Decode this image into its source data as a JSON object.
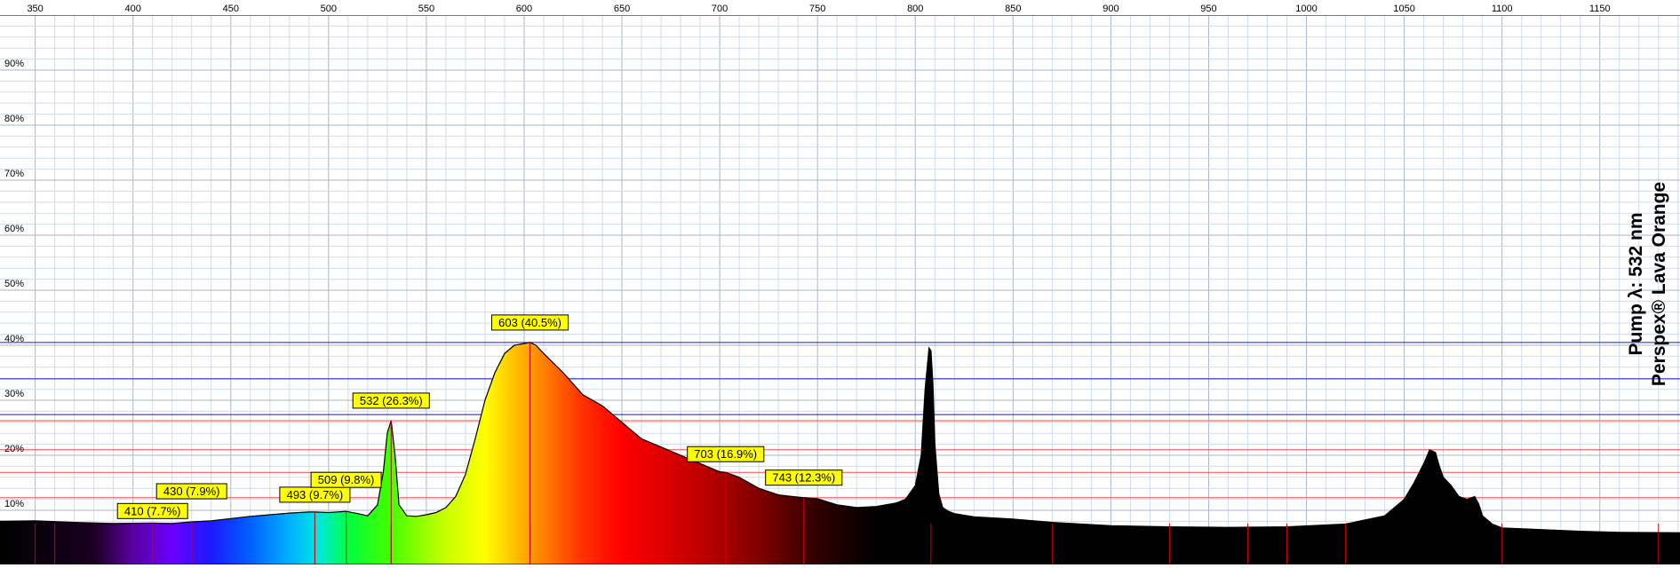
{
  "chart_data": {
    "type": "area",
    "title": "",
    "xlabel": "",
    "ylabel": "",
    "xlim": [
      332,
      1191
    ],
    "ylim": [
      0,
      100
    ],
    "x_ticks": [
      350,
      400,
      450,
      500,
      550,
      600,
      650,
      700,
      750,
      800,
      850,
      900,
      950,
      1000,
      1050,
      1100,
      1150
    ],
    "y_ticks": [
      {
        "value": 10,
        "label": "10%"
      },
      {
        "value": 20,
        "label": "20%"
      },
      {
        "value": 30,
        "label": "30%"
      },
      {
        "value": 40,
        "label": "40%"
      },
      {
        "value": 50,
        "label": "50%"
      },
      {
        "value": 60,
        "label": "60%"
      },
      {
        "value": 70,
        "label": "70%"
      },
      {
        "value": 80,
        "label": "80%"
      },
      {
        "value": 90,
        "label": "90%"
      }
    ],
    "grid": true,
    "annotation_lines": {
      "blue_y": [
        40.5,
        33.9,
        27.4
      ],
      "red_y": [
        26.3,
        21.0,
        16.9,
        12.3
      ]
    },
    "peaks": [
      {
        "x": 410,
        "y": 7.7,
        "label": "410 (7.7%)"
      },
      {
        "x": 430,
        "y": 7.9,
        "label": "430 (7.9%)"
      },
      {
        "x": 493,
        "y": 9.7,
        "label": "493 (9.7%)"
      },
      {
        "x": 509,
        "y": 9.8,
        "label": "509 (9.8%)"
      },
      {
        "x": 532,
        "y": 26.3,
        "label": "532 (26.3%)"
      },
      {
        "x": 603,
        "y": 40.5,
        "label": "603 (40.5%)"
      },
      {
        "x": 703,
        "y": 16.9,
        "label": "703 (16.9%)"
      },
      {
        "x": 743,
        "y": 12.3,
        "label": "743 (12.3%)"
      }
    ],
    "spectrum": {
      "x": [
        332,
        350,
        370,
        390,
        410,
        420,
        430,
        440,
        450,
        460,
        470,
        480,
        490,
        493,
        500,
        509,
        515,
        520,
        525,
        528,
        530,
        532,
        534,
        536,
        540,
        545,
        550,
        555,
        560,
        565,
        570,
        575,
        580,
        585,
        590,
        595,
        600,
        603,
        606,
        610,
        620,
        630,
        640,
        650,
        660,
        670,
        680,
        690,
        700,
        703,
        710,
        720,
        730,
        740,
        743,
        750,
        760,
        770,
        780,
        790,
        795,
        800,
        803,
        805,
        807,
        808,
        809,
        810,
        812,
        814,
        817,
        820,
        830,
        850,
        870,
        900,
        930,
        960,
        990,
        1020,
        1040,
        1050,
        1055,
        1060,
        1063,
        1066,
        1068,
        1070,
        1074,
        1078,
        1082,
        1086,
        1088,
        1090,
        1095,
        1100,
        1120,
        1140,
        1160,
        1191
      ],
      "y": [
        8.0,
        8.1,
        7.8,
        7.6,
        7.7,
        7.6,
        7.9,
        8.1,
        8.5,
        8.9,
        9.2,
        9.5,
        9.7,
        9.7,
        9.6,
        9.8,
        9.4,
        9.0,
        11.0,
        17.0,
        24.0,
        26.3,
        20.0,
        11.0,
        9.0,
        8.9,
        9.2,
        9.6,
        10.5,
        12.5,
        16.5,
        23.0,
        30.0,
        35.0,
        38.5,
        40.0,
        40.3,
        40.5,
        40.0,
        38.5,
        35.0,
        31.0,
        29.0,
        26.0,
        23.0,
        21.5,
        20.0,
        18.5,
        17.0,
        16.9,
        16.0,
        14.0,
        12.8,
        12.4,
        12.3,
        12.1,
        11.0,
        10.5,
        10.7,
        11.3,
        12.0,
        14.5,
        20.0,
        32.0,
        39.5,
        39.0,
        33.0,
        22.0,
        13.0,
        10.5,
        9.8,
        9.4,
        8.8,
        8.4,
        7.8,
        7.2,
        7.0,
        6.9,
        7.0,
        7.5,
        9.0,
        12.0,
        15.0,
        18.5,
        21.0,
        20.5,
        18.0,
        16.0,
        14.5,
        12.5,
        12.0,
        12.5,
        11.2,
        9.0,
        7.5,
        6.8,
        6.5,
        6.2,
        6.0,
        5.9
      ]
    },
    "colors": {
      "grid": "#cfdcec",
      "blue_line": "#1a1ac8",
      "red_line": "#ff4a4a",
      "label_fill": "#ffff00",
      "tick_mark": "#cc0000",
      "border": "#3fa83f"
    }
  },
  "side_title": {
    "line1": "Pump λ: 532 nm",
    "line2": "Perspex® Lava Orange"
  }
}
